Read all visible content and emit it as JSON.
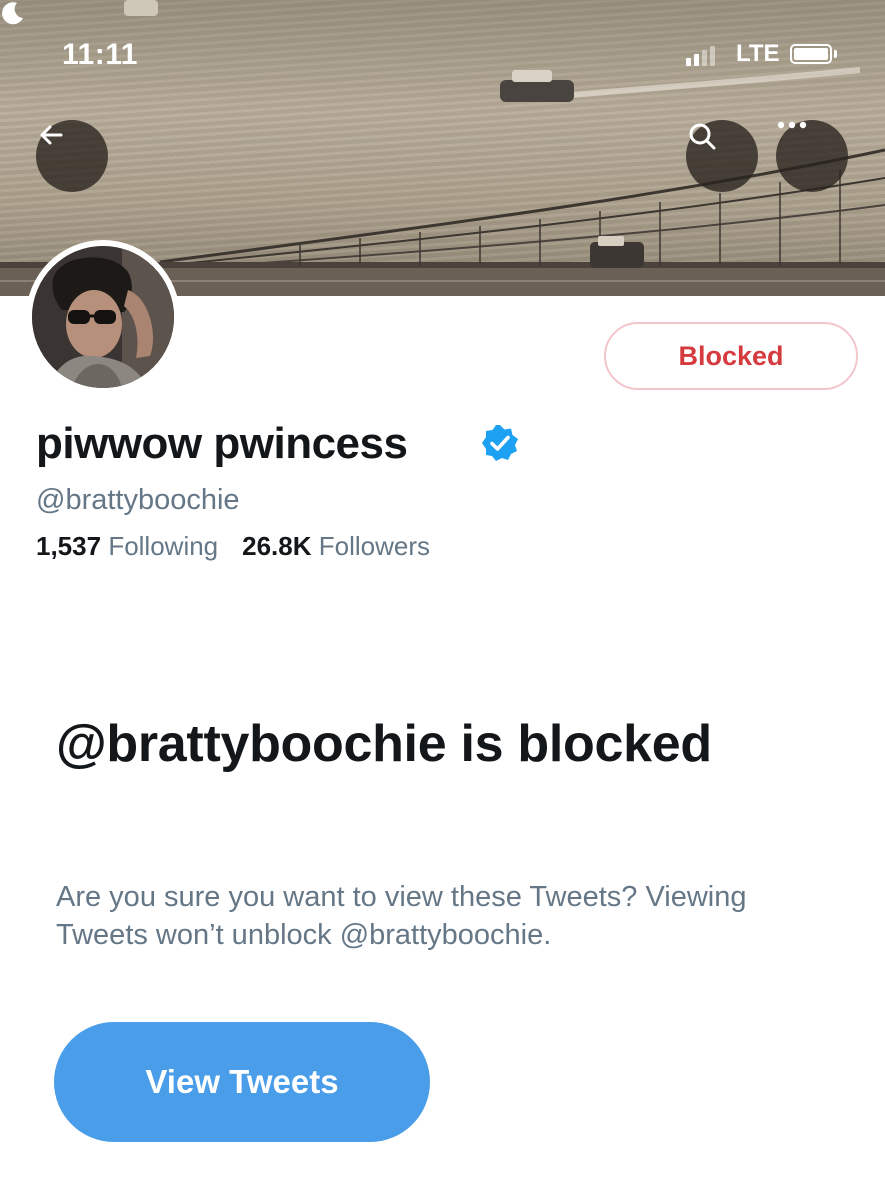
{
  "status_bar": {
    "time": "11:11",
    "network": "LTE",
    "icons": [
      "moon-icon",
      "signal-icon",
      "battery-icon"
    ]
  },
  "header": {
    "icons": [
      "back-arrow-icon",
      "search-icon",
      "more-icon"
    ]
  },
  "profile": {
    "display_name": "piwwow pwincess",
    "handle": "@brattyboochie",
    "verified": true,
    "following_count": "1,537",
    "following_label": "Following",
    "followers_count": "26.8K",
    "followers_label": "Followers",
    "blocked_label": "Blocked"
  },
  "blocked_notice": {
    "title": "@brattyboochie is blocked",
    "description": "Are you sure you want to view these Tweets? Viewing Tweets won’t unblock @brattyboochie.",
    "button_label": "View Tweets"
  },
  "colors": {
    "accent": "#4a9de9",
    "blocked_red": "#d53a3f",
    "secondary_text": "#657786",
    "verified_blue": "#1da1f2"
  }
}
